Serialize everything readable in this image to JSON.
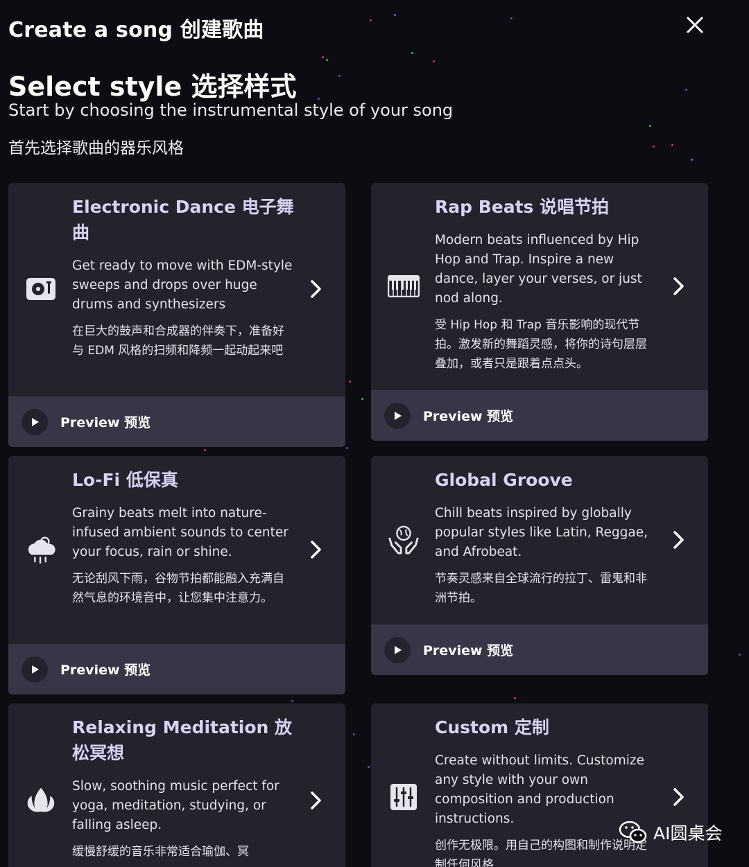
{
  "header": {
    "title": "Create a song 创建歌曲",
    "close_icon": "close-icon"
  },
  "intro": {
    "title": "Select style 选择样式",
    "subtitle_en": "Start by choosing the instrumental style of your song",
    "subtitle_zh": "首先选择歌曲的器乐风格"
  },
  "preview_label": "Preview 预览",
  "cards": [
    {
      "icon": "turntable-icon",
      "title": "Electronic Dance 电子舞曲",
      "desc": "Get ready to move with EDM-style sweeps and drops over huge drums and synthesizers",
      "desc_zh": "在巨大的鼓声和合成器的伴奏下，准备好与 EDM 风格的扫频和降频一起动起来吧"
    },
    {
      "icon": "keyboard-icon",
      "title": "Rap Beats 说唱节拍",
      "desc": "Modern beats influenced by Hip Hop and Trap. Inspire a new dance, layer your verses, or just nod along.",
      "desc_zh": "受 Hip Hop 和 Trap 音乐影响的现代节拍。激发新的舞蹈灵感，将你的诗句层层叠加，或者只是跟着点点头。"
    },
    {
      "icon": "cloud-rain-icon",
      "title": "Lo-Fi 低保真",
      "desc": "Grainy beats melt into nature-infused ambient sounds to center your focus, rain or shine.",
      "desc_zh": "无论刮风下雨，谷物节拍都能融入充满自然气息的环境音中，让您集中注意力。"
    },
    {
      "icon": "globe-hands-icon",
      "title": "Global Groove",
      "desc": "Chill beats inspired by globally popular styles like Latin, Reggae, and Afrobeat.",
      "desc_zh": "节奏灵感来自全球流行的拉丁、雷鬼和非洲节拍。"
    },
    {
      "icon": "lotus-icon",
      "title": "Relaxing Meditation 放松冥想",
      "desc": "Slow, soothing music perfect for yoga, meditation, studying, or falling asleep.",
      "desc_zh": "缓慢舒缓的音乐非常适合瑜伽、冥"
    },
    {
      "icon": "sliders-icon",
      "title": "Custom 定制",
      "desc": "Create without limits. Customize any style with your own composition and production instructions.",
      "desc_zh": "创作无极限。用自己的构图和制作说明定制任何风格"
    }
  ],
  "watermark": {
    "icon": "wechat-icon",
    "text": "AI圆桌会"
  },
  "colors": {
    "background": "#0d0c12",
    "card": "#24222d",
    "preview_bar": "#383646",
    "card_title": "#d8d2f2"
  }
}
